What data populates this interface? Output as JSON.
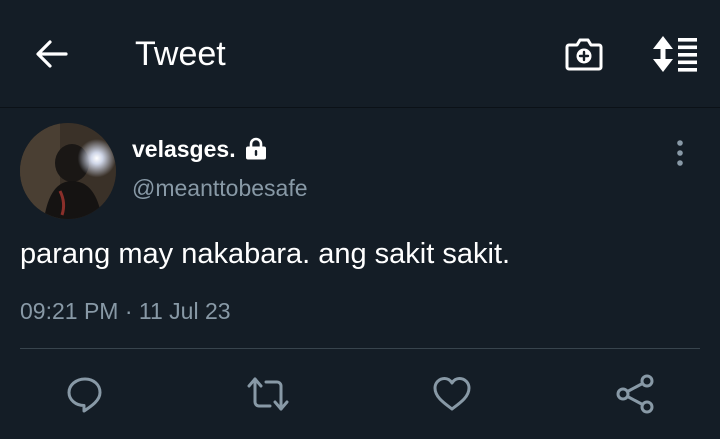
{
  "header": {
    "title": "Tweet",
    "icons": [
      "back-arrow-icon",
      "camera-plus-icon",
      "sort-icon"
    ]
  },
  "tweet": {
    "display_name": "velasges.",
    "protected": true,
    "handle": "@meanttobesafe",
    "text": "parang may nakabara. ang sakit sakit.",
    "timestamp": "09:21 PM · 11 Jul 23"
  },
  "actions": [
    "reply-icon",
    "retweet-icon",
    "like-icon",
    "share-icon"
  ],
  "colors": {
    "background": "#141d26",
    "primary_text": "#ffffff",
    "secondary_text": "#8899a6",
    "icon": "#8899a6",
    "divider": "#38444d"
  }
}
